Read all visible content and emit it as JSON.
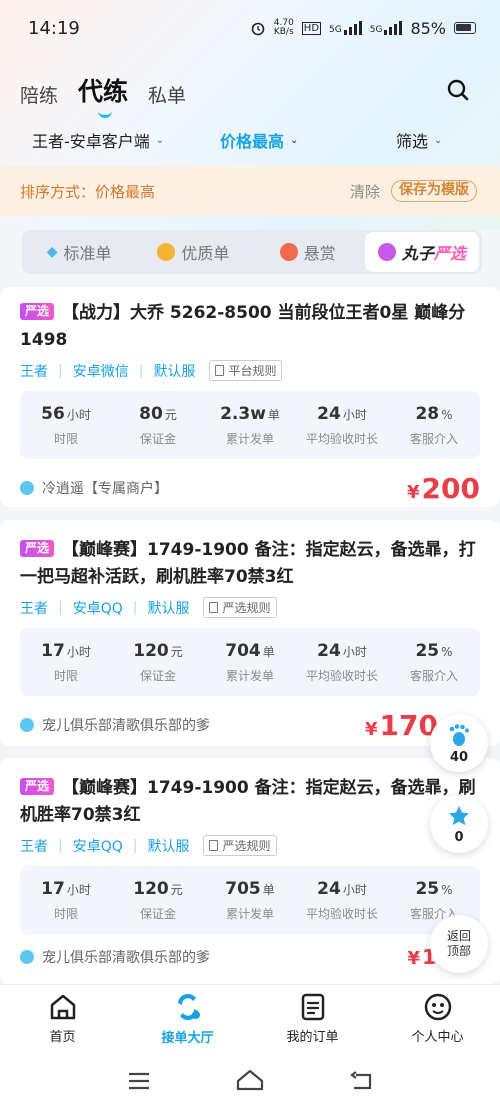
{
  "status": {
    "time": "14:19",
    "net_speed_top": "4.70",
    "net_speed_bottom": "KB/s",
    "hd": "HD",
    "sig1": "5G",
    "sig2": "5G",
    "battery": "85%"
  },
  "header": {
    "tabs": [
      {
        "label": "陪练"
      },
      {
        "label": "代练"
      },
      {
        "label": "私单"
      }
    ],
    "search_icon": "search-icon"
  },
  "filters": {
    "platform": "王者-安卓客户端",
    "sort": "价格最高",
    "filter": "筛选"
  },
  "sortbar": {
    "label": "排序方式：价格最高",
    "clear": "清除",
    "save": "保存为模版"
  },
  "segments": [
    {
      "label": "标准单",
      "icon": "diamond-icon",
      "color": "#49b6f1"
    },
    {
      "label": "优质单",
      "icon": "quality-icon",
      "color": "#f5b233"
    },
    {
      "label": "悬赏",
      "icon": "reward-icon",
      "color": "#f06b4b"
    },
    {
      "label_a": "丸子",
      "label_b": "严选",
      "icon": "wanzi-icon",
      "color": "#c65ae6"
    }
  ],
  "orders": [
    {
      "tag": "严选",
      "title": "【战力】大乔 5262-8500 当前段位王者0星 巅峰分1498",
      "meta": [
        "王者",
        "安卓微信",
        "默认服"
      ],
      "rule": "平台规则",
      "stats": [
        {
          "v": "56",
          "u": "小时",
          "l": "时限"
        },
        {
          "v": "80",
          "u": "元",
          "l": "保证金"
        },
        {
          "v": "2.3w",
          "u": "单",
          "l": "累计发单"
        },
        {
          "v": "24",
          "u": "小时",
          "l": "平均验收时长"
        },
        {
          "v": "28",
          "u": "%",
          "l": "客服介入"
        }
      ],
      "merchant": "冷逍遥【专属商户】",
      "price": "200"
    },
    {
      "tag": "严选",
      "title": "【巅峰赛】1749-1900 备注：指定赵云，备选暃，打一把马超补活跃，刷机胜率70禁3红",
      "meta": [
        "王者",
        "安卓QQ",
        "默认服"
      ],
      "rule": "严选规则",
      "stats": [
        {
          "v": "17",
          "u": "小时",
          "l": "时限"
        },
        {
          "v": "120",
          "u": "元",
          "l": "保证金"
        },
        {
          "v": "704",
          "u": "单",
          "l": "累计发单"
        },
        {
          "v": "24",
          "u": "小时",
          "l": "平均验收时长"
        },
        {
          "v": "25",
          "u": "%",
          "l": "客服介入"
        }
      ],
      "merchant": "宠儿俱乐部清歌俱乐部的爹",
      "price": "170"
    },
    {
      "tag": "严选",
      "title": "【巅峰赛】1749-1900 备注：指定赵云，备选暃，刷机胜率70禁3红",
      "meta": [
        "王者",
        "安卓QQ",
        "默认服"
      ],
      "rule": "严选规则",
      "stats": [
        {
          "v": "17",
          "u": "小时",
          "l": "时限"
        },
        {
          "v": "120",
          "u": "元",
          "l": "保证金"
        },
        {
          "v": "705",
          "u": "单",
          "l": "累计发单"
        },
        {
          "v": "24",
          "u": "小时",
          "l": "平均验收时长"
        },
        {
          "v": "25",
          "u": "%",
          "l": "客服介入"
        }
      ],
      "merchant": "宠儿俱乐部清歌俱乐部的爹",
      "price": "1"
    }
  ],
  "floats": {
    "footprint_count": "40",
    "favorite_count": "0",
    "back_top": "返回顶部"
  },
  "nav": [
    {
      "label": "首页"
    },
    {
      "label": "接单大厅"
    },
    {
      "label": "我的订单"
    },
    {
      "label": "个人中心"
    }
  ],
  "colors": {
    "accent": "#17a1e4",
    "price": "#ea3d47",
    "sort_text": "#d07a2a"
  }
}
